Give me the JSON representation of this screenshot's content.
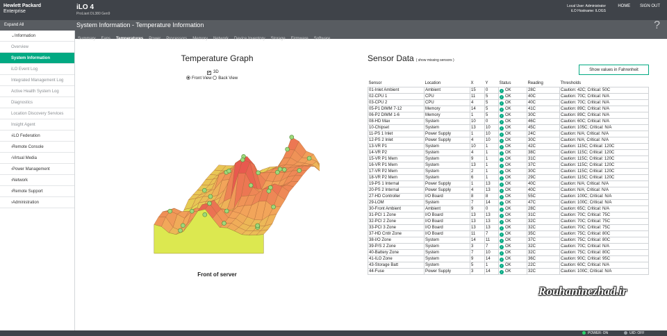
{
  "header": {
    "brand_line1": "Hewlett Packard",
    "brand_line2": "Enterprise",
    "product": "iLO 4",
    "model": "ProLiant DL380 Gen9",
    "local_user": "Local User: Administrator",
    "hostname": "iLO Hostname: ILOGS",
    "home": "HOME",
    "signout": "SIGN OUT"
  },
  "subheader": {
    "expand_all": "Expand All",
    "title": "System Information - Temperature Information",
    "help": "?"
  },
  "tabs": [
    "Summary",
    "Fans",
    "Temperatures",
    "Power",
    "Processors",
    "Memory",
    "Network",
    "Device Inventory",
    "Storage",
    "Firmware",
    "Software"
  ],
  "sidebar": [
    {
      "label": "Information",
      "type": "section",
      "open": true
    },
    {
      "label": "Overview",
      "type": "sub"
    },
    {
      "label": "System Information",
      "type": "sub",
      "active": true
    },
    {
      "label": "iLO Event Log",
      "type": "sub"
    },
    {
      "label": "Integrated Management Log",
      "type": "sub"
    },
    {
      "label": "Active Health System Log",
      "type": "sub"
    },
    {
      "label": "Diagnostics",
      "type": "sub"
    },
    {
      "label": "Location Discovery Services",
      "type": "sub"
    },
    {
      "label": "Insight Agent",
      "type": "sub"
    },
    {
      "label": "iLO Federation",
      "type": "section"
    },
    {
      "label": "Remote Console",
      "type": "section"
    },
    {
      "label": "Virtual Media",
      "type": "section"
    },
    {
      "label": "Power Management",
      "type": "section"
    },
    {
      "label": "Network",
      "type": "section"
    },
    {
      "label": "Remote Support",
      "type": "section"
    },
    {
      "label": "Administration",
      "type": "section"
    }
  ],
  "graph": {
    "title": "Temperature Graph",
    "option_3d": "3D",
    "front_view": "Front View",
    "back_view": "Back View",
    "caption": "Front of server",
    "colors": {
      "cool": "#dce850",
      "mid": "#f2a65a",
      "hot": "#e8594f",
      "peak": "#9fd87a"
    }
  },
  "sensors": {
    "title": "Sensor Data",
    "missing_link": "( show missing sensors )",
    "fahrenheit_button": "Show values in Fahrenheit",
    "columns": [
      "Sensor",
      "Location",
      "X",
      "Y",
      "Status",
      "Reading",
      "Thresholds"
    ],
    "rows": [
      [
        "01-Inlet Ambient",
        "Ambient",
        "15",
        "0",
        "OK",
        "28C",
        "Caution: 42C; Critical: 50C"
      ],
      [
        "02-CPU 1",
        "CPU",
        "11",
        "5",
        "OK",
        "40C",
        "Caution: 70C; Critical: N/A"
      ],
      [
        "03-CPU 2",
        "CPU",
        "4",
        "5",
        "OK",
        "40C",
        "Caution: 70C; Critical: N/A"
      ],
      [
        "05-P1 DIMM 7-12",
        "Memory",
        "14",
        "5",
        "OK",
        "41C",
        "Caution: 89C; Critical: N/A"
      ],
      [
        "06-P2 DIMM 1-6",
        "Memory",
        "1",
        "5",
        "OK",
        "30C",
        "Caution: 89C; Critical: N/A"
      ],
      [
        "08-HD Max",
        "System",
        "10",
        "0",
        "OK",
        "46C",
        "Caution: 60C; Critical: N/A"
      ],
      [
        "10-Chipset",
        "System",
        "13",
        "10",
        "OK",
        "45C",
        "Caution: 105C; Critical: N/A"
      ],
      [
        "11-PS 1 Inlet",
        "Power Supply",
        "1",
        "10",
        "OK",
        "24C",
        "Caution: N/A; Critical: N/A"
      ],
      [
        "12-PS 2 Inlet",
        "Power Supply",
        "4",
        "10",
        "OK",
        "30C",
        "Caution: N/A; Critical: N/A"
      ],
      [
        "13-VR P1",
        "System",
        "10",
        "1",
        "OK",
        "42C",
        "Caution: 115C; Critical: 120C"
      ],
      [
        "14-VR P2",
        "System",
        "4",
        "1",
        "OK",
        "38C",
        "Caution: 115C; Critical: 120C"
      ],
      [
        "15-VR P1 Mem",
        "System",
        "9",
        "1",
        "OK",
        "31C",
        "Caution: 115C; Critical: 120C"
      ],
      [
        "16-VR P1 Mem",
        "System",
        "13",
        "1",
        "OK",
        "37C",
        "Caution: 115C; Critical: 120C"
      ],
      [
        "17-VR P2 Mem",
        "System",
        "2",
        "1",
        "OK",
        "30C",
        "Caution: 115C; Critical: 120C"
      ],
      [
        "18-VR P2 Mem",
        "System",
        "6",
        "1",
        "OK",
        "29C",
        "Caution: 115C; Critical: 120C"
      ],
      [
        "19-PS 1 Internal",
        "Power Supply",
        "1",
        "13",
        "OK",
        "40C",
        "Caution: N/A; Critical: N/A"
      ],
      [
        "20-PS 2 Internal",
        "Power Supply",
        "4",
        "13",
        "OK",
        "40C",
        "Caution: N/A; Critical: N/A"
      ],
      [
        "27-HD Controller",
        "I/O Board",
        "8",
        "8",
        "OK",
        "55C",
        "Caution: 100C; Critical: N/A"
      ],
      [
        "29-LOM",
        "System",
        "7",
        "14",
        "OK",
        "47C",
        "Caution: 100C; Critical: N/A"
      ],
      [
        "30-Front Ambient",
        "Ambient",
        "9",
        "0",
        "OK",
        "28C",
        "Caution: 65C; Critical: N/A"
      ],
      [
        "31-PCI 1 Zone",
        "I/O Board",
        "13",
        "13",
        "OK",
        "31C",
        "Caution: 70C; Critical: 75C"
      ],
      [
        "32-PCI 2 Zone",
        "I/O Board",
        "13",
        "13",
        "OK",
        "32C",
        "Caution: 70C; Critical: 75C"
      ],
      [
        "33-PCI 3 Zone",
        "I/O Board",
        "13",
        "13",
        "OK",
        "32C",
        "Caution: 70C; Critical: 75C"
      ],
      [
        "37-HD Cntlr Zone",
        "I/O Board",
        "11",
        "7",
        "OK",
        "35C",
        "Caution: 75C; Critical: 80C"
      ],
      [
        "38-I/O Zone",
        "System",
        "14",
        "11",
        "OK",
        "37C",
        "Caution: 75C; Critical: 80C"
      ],
      [
        "39-P/S 2 Zone",
        "System",
        "3",
        "7",
        "OK",
        "32C",
        "Caution: 70C; Critical: N/A"
      ],
      [
        "40-Battery Zone",
        "System",
        "7",
        "10",
        "OK",
        "32C",
        "Caution: 75C; Critical: 80C"
      ],
      [
        "41-ILO Zone",
        "System",
        "9",
        "14",
        "OK",
        "36C",
        "Caution: 90C; Critical: 95C"
      ],
      [
        "43-Storage Batt",
        "System",
        "5",
        "1",
        "OK",
        "22C",
        "Caution: 60C; Critical: N/A"
      ],
      [
        "44-Fuse",
        "Power Supply",
        "3",
        "14",
        "OK",
        "32C",
        "Caution: 100C; Critical: N/A"
      ]
    ]
  },
  "footer": {
    "power": "POWER: ON",
    "uid": "UID: OFF"
  },
  "watermark": "Rouhaninezhad.ir"
}
